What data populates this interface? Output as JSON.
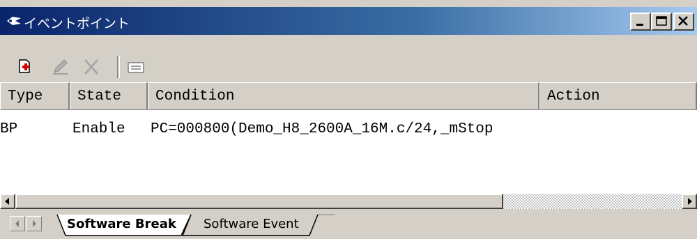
{
  "window": {
    "title": "イベントポイント",
    "controls": [
      "minimize",
      "maximize",
      "close"
    ]
  },
  "toolbar": {
    "buttons": [
      {
        "name": "add-event-point",
        "icon": "add-document-icon",
        "enabled": true
      },
      {
        "name": "edit-event-point",
        "icon": "pencil-icon",
        "enabled": false
      },
      {
        "name": "delete-event-point",
        "icon": "delete-x-icon",
        "enabled": false
      },
      {
        "name": "properties",
        "icon": "list-icon",
        "enabled": true
      }
    ]
  },
  "grid": {
    "columns": [
      "Type",
      "State",
      "Condition",
      "Action"
    ],
    "rows": [
      {
        "type": "BP",
        "state": "Enable",
        "condition": "PC=000800(Demo_H8_2600A_16M.c/24,_mStop",
        "action": ""
      }
    ]
  },
  "tabs": {
    "items": [
      {
        "label": "Software Break",
        "active": true
      },
      {
        "label": "Software Event",
        "active": false
      }
    ]
  },
  "colors": {
    "title_gradient_start": "#0a246a",
    "title_gradient_end": "#a6caf0",
    "face": "#d4d0c8"
  }
}
